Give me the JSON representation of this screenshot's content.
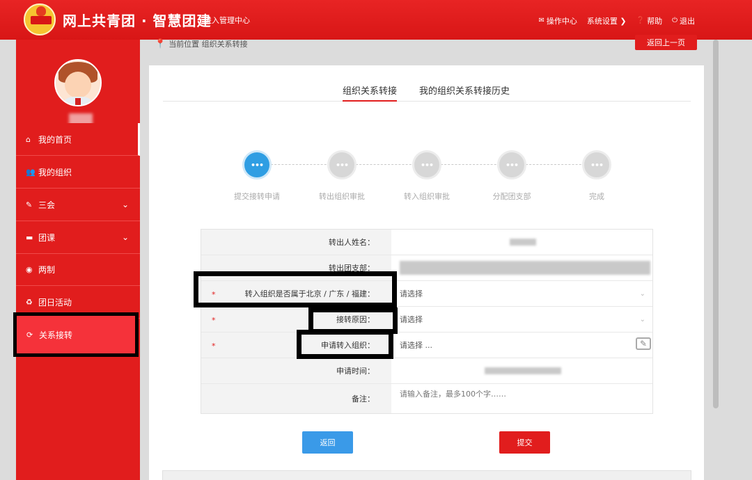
{
  "header": {
    "brand": "网上共青团 · 智慧团建",
    "admin_link": "进入管理中心",
    "nav": [
      {
        "icon": "mail-icon",
        "glyph": "✉",
        "label": "操作中心"
      },
      {
        "icon": "settings-icon",
        "glyph": "",
        "label": "系统设置 ❯"
      },
      {
        "icon": "help-icon",
        "glyph": "❓",
        "label": "帮助"
      },
      {
        "icon": "power-icon",
        "glyph": "⏻",
        "label": "退出"
      }
    ]
  },
  "sidebar": {
    "items": [
      {
        "icon": "home-icon",
        "glyph": "⌂",
        "label": "我的首页"
      },
      {
        "icon": "group-icon",
        "glyph": "👥",
        "label": "我的组织"
      },
      {
        "icon": "edit-icon",
        "glyph": "✎",
        "label": "三会"
      },
      {
        "icon": "folder-icon",
        "glyph": "▬",
        "label": "团课"
      },
      {
        "icon": "circle-icon",
        "glyph": "◉",
        "label": "两制"
      },
      {
        "icon": "recycle-icon",
        "glyph": "♻",
        "label": "团日活动"
      },
      {
        "icon": "refresh-icon",
        "glyph": "⟳",
        "label": "关系接转"
      }
    ]
  },
  "breadcrumb": "当前位置 组织关系转接",
  "back_top": "返回上一页",
  "tabs": [
    "组织关系转接",
    "我的组织关系转接历史"
  ],
  "steps": [
    {
      "label": "提交接转申请",
      "done": true
    },
    {
      "label": "转出组织审批",
      "done": false
    },
    {
      "label": "转入组织审批",
      "done": false
    },
    {
      "label": "分配团支部",
      "done": false
    },
    {
      "label": "完成",
      "done": false
    }
  ],
  "step_dots": "•••",
  "form": {
    "rows": [
      {
        "label": "转出人姓名：",
        "value": "",
        "required": false
      },
      {
        "label": "转出团支部：",
        "value": "",
        "required": false
      },
      {
        "label": "转入组织是否属于北京 / 广东 / 福建：",
        "value": "请选择",
        "required": true
      },
      {
        "label": "接转原因：",
        "value": "请选择",
        "required": true
      },
      {
        "label": "申请转入组织：",
        "value": "请选择 ...",
        "required": true
      },
      {
        "label": "申请时间：",
        "value": "",
        "required": false
      },
      {
        "label": "备注：",
        "value": "请输入备注，最多100个字……",
        "required": false
      }
    ]
  },
  "buttons": {
    "back": "返回",
    "submit": "提交"
  }
}
